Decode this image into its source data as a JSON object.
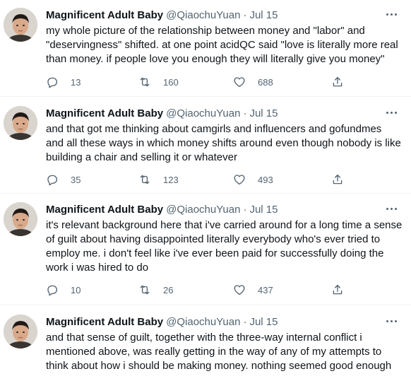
{
  "tweets": [
    {
      "name": "Magnificent Adult Baby",
      "handle": "@QiaochuYuan",
      "sep": "·",
      "date": "Jul 15",
      "text": "my whole picture of the relationship between money and \"labor\" and\n\"deservingness\" shifted. at one point acidQC said \"love is literally more real\nthan money. if people love you enough they will literally give you money\"",
      "replies": "13",
      "retweets": "160",
      "likes": "688"
    },
    {
      "name": "Magnificent Adult Baby",
      "handle": "@QiaochuYuan",
      "sep": "·",
      "date": "Jul 15",
      "text": "and that got me thinking about camgirls and influencers and gofundmes\nand all these ways in which money shifts around even though nobody is like\nbuilding a chair and selling it or whatever",
      "replies": "35",
      "retweets": "123",
      "likes": "493"
    },
    {
      "name": "Magnificent Adult Baby",
      "handle": "@QiaochuYuan",
      "sep": "·",
      "date": "Jul 15",
      "text": "it's relevant background here that i've carried around for a long time a sense\nof guilt about having disappointed literally everybody who's ever tried to\nemploy me. i don't feel like i've ever been paid for successfully doing the\nwork i was hired to do",
      "replies": "10",
      "retweets": "26",
      "likes": "437"
    },
    {
      "name": "Magnificent Adult Baby",
      "handle": "@QiaochuYuan",
      "sep": "·",
      "date": "Jul 15",
      "text": "and that sense of guilt, together with the three-way internal conflict i\nmentioned above, was really getting in the way of any of my attempts to\nthink about how i should be making money. nothing seemed good enough",
      "replies": "",
      "retweets": "",
      "likes": ""
    }
  ],
  "icons": {
    "reply": "reply-icon",
    "retweet": "retweet-icon",
    "like": "heart-icon",
    "share": "share-icon",
    "more": "more-icon"
  },
  "colors": {
    "text": "#0f1419",
    "secondary": "#536471",
    "divider": "#eff3f4"
  }
}
